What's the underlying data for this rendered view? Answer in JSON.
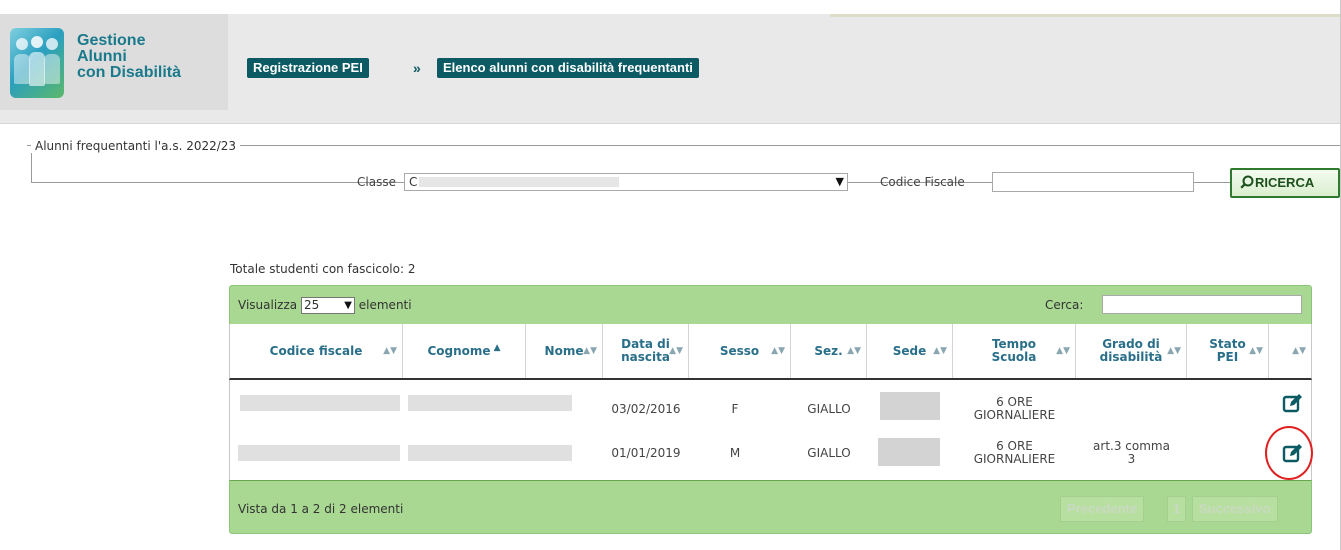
{
  "header": {
    "logo_lines": [
      "Gestione",
      "Alunni",
      "con Disabilità"
    ],
    "breadcrumb_1": "Registrazione PEI",
    "breadcrumb_sep": "»",
    "breadcrumb_2": "Elenco alunni con disabilità frequentanti"
  },
  "filter": {
    "legend": "Alunni frequentanti l'a.s. 2022/23",
    "classe_label": "Classe",
    "classe_value": "C",
    "codice_fiscale_label": "Codice Fiscale",
    "codice_fiscale_value": "",
    "search_button": "RICERCA"
  },
  "table": {
    "total_label": "Totale studenti con fascicolo: 2",
    "show_prefix": "Visualizza",
    "page_size": "25",
    "show_suffix": "elementi",
    "search_label": "Cerca:",
    "search_value": "",
    "columns": [
      "Codice fiscale",
      "Cognome",
      "Nome",
      "Data di\nnascita",
      "Sesso",
      "Sez.",
      "Sede",
      "Tempo\nScuola",
      "Grado di\ndisabilità",
      "Stato\nPEI",
      ""
    ],
    "rows": [
      {
        "data_nascita": "03/02/2016",
        "sesso": "F",
        "sezione": "GIALLO",
        "tempo_scuola": "6 ORE\nGIORNALIERE",
        "grado_disabilita": "",
        "stato_pei": "",
        "action_icon": "edit-icon"
      },
      {
        "data_nascita": "01/01/2019",
        "sesso": "M",
        "sezione": "GIALLO",
        "tempo_scuola": "6 ORE\nGIORNALIERE",
        "grado_disabilita": "art.3 comma\n3",
        "stato_pei": "",
        "action_icon": "edit-icon"
      }
    ],
    "footer_info": "Vista da 1 a 2 di 2 elementi",
    "pager_prev": "Precedente",
    "pager_page": "1",
    "pager_next": "Successivo"
  },
  "colors": {
    "teal_dark": "#0c5a63",
    "table_green": "#a9d892",
    "header_link_blue": "#2a6f8a",
    "highlight_red": "#e02020"
  }
}
